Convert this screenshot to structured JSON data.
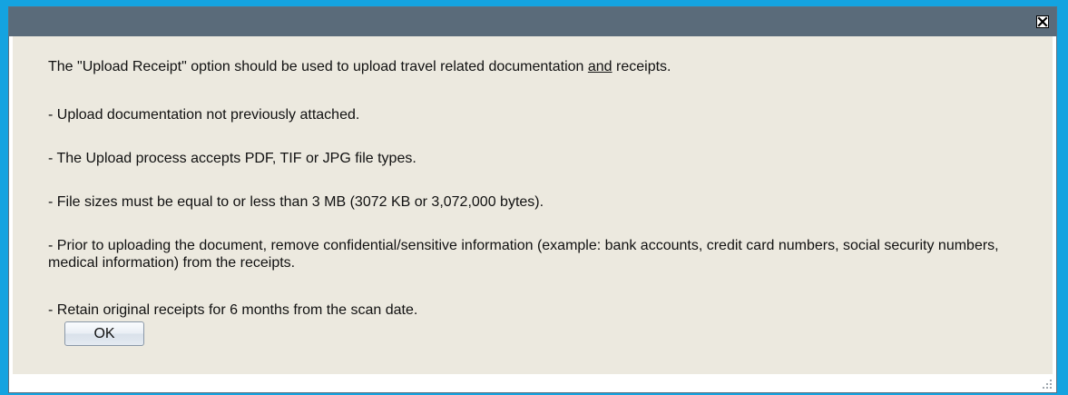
{
  "dialog": {
    "close_icon": "close-x-icon",
    "lines": {
      "intro_before": "The \"Upload Receipt\" option should be used to upload travel related documentation ",
      "intro_underlined": "and",
      "intro_after": " receipts.",
      "line1": "- Upload documentation not previously attached.",
      "line2": "- The Upload process accepts PDF, TIF or JPG file types.",
      "line3": "- File sizes must be equal to or less than 3 MB (3072 KB or 3,072,000 bytes).",
      "line4": "- Prior to uploading the document, remove confidential/sensitive information (example: bank accounts, credit card numbers, social security numbers, medical information) from the receipts.",
      "line5": "- Retain original receipts for 6 months from the scan date."
    },
    "ok_label": "OK",
    "resize_icon": "resize-grip-icon"
  },
  "colors": {
    "background": "#14a3e0",
    "titlebar": "#5a6b7a",
    "content": "#ece9df"
  }
}
